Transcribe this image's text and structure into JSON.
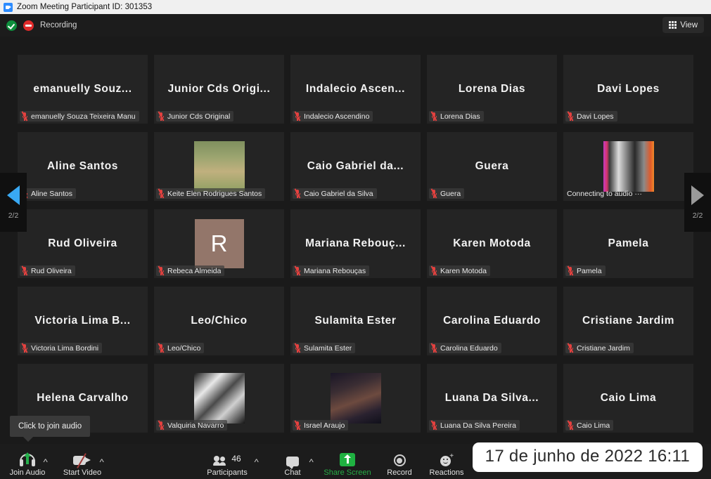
{
  "window": {
    "title": "Zoom Meeting Participant ID: 301353",
    "app_icon": "zoom-icon"
  },
  "header": {
    "encryption_icon": "shield-check-icon",
    "recording_icon": "recording-icon",
    "recording_label": "Recording",
    "view_button": {
      "label": "View",
      "icon": "grid-icon"
    }
  },
  "gallery": {
    "columns": 5,
    "rows": 5,
    "nav": {
      "prev_icon": "chevron-left-icon",
      "prev_page_label": "2/2",
      "next_icon": "chevron-right-icon",
      "next_page_label": "2/2",
      "prev_color": "#39a9f4",
      "next_color": "#9a9a9a"
    },
    "mute_icon": "microphone-off-icon",
    "mute_color": "#e5413f",
    "tiles": [
      {
        "display_name": "emanuelly Souz...",
        "footer_name": "emanuelly Souza Teixeira Manu",
        "muted": true,
        "media": "name"
      },
      {
        "display_name": "Junior Cds Origi...",
        "footer_name": "Junior Cds Original",
        "muted": true,
        "media": "name"
      },
      {
        "display_name": "Indalecio  Ascen...",
        "footer_name": "Indalecio Ascendino",
        "muted": true,
        "media": "name"
      },
      {
        "display_name": "Lorena Dias",
        "footer_name": "Lorena Dias",
        "muted": true,
        "media": "name"
      },
      {
        "display_name": "Davi Lopes",
        "footer_name": "Davi Lopes",
        "muted": true,
        "media": "name"
      },
      {
        "display_name": "Aline Santos",
        "footer_name": "Aline Santos",
        "muted": true,
        "media": "name"
      },
      {
        "display_name": "",
        "footer_name": "Keite Elen Rodrigues Santos",
        "muted": true,
        "media": "photo",
        "photo_style": "outdoor-portrait"
      },
      {
        "display_name": "Caio Gabriel da...",
        "footer_name": "Caio Gabriel da Silva",
        "muted": true,
        "media": "name"
      },
      {
        "display_name": "Guera",
        "footer_name": "Guera",
        "muted": true,
        "media": "name"
      },
      {
        "display_name": "",
        "footer_name": "Connecting to audio ···",
        "muted": false,
        "media": "photo",
        "photo_style": "bw-portrait-gradient"
      },
      {
        "display_name": "Rud Oliveira",
        "footer_name": "Rud Oliveira",
        "muted": true,
        "media": "name"
      },
      {
        "display_name": "",
        "footer_name": "Rebeca Almeida",
        "muted": true,
        "media": "initial",
        "initial": "R",
        "initial_bg": "#93766a"
      },
      {
        "display_name": "Mariana Rebouç...",
        "footer_name": "Mariana Rebouças",
        "muted": true,
        "media": "name"
      },
      {
        "display_name": "Karen Motoda",
        "footer_name": "Karen Motoda",
        "muted": true,
        "media": "name"
      },
      {
        "display_name": "Pamela",
        "footer_name": "Pamela",
        "muted": true,
        "media": "name"
      },
      {
        "display_name": "Victoria  Lima  B...",
        "footer_name": "Victoria Lima Bordini",
        "muted": true,
        "media": "name"
      },
      {
        "display_name": "Leo/Chico",
        "footer_name": "Leo/Chico",
        "muted": true,
        "media": "name"
      },
      {
        "display_name": "Sulamita Ester",
        "footer_name": "Sulamita Ester",
        "muted": true,
        "media": "name"
      },
      {
        "display_name": "Carolina Eduardo",
        "footer_name": "Carolina Eduardo",
        "muted": true,
        "media": "name"
      },
      {
        "display_name": "Cristiane Jardim",
        "footer_name": "Cristiane Jardim",
        "muted": true,
        "media": "name"
      },
      {
        "display_name": "Helena Carvalho",
        "footer_name": "",
        "muted": false,
        "media": "name"
      },
      {
        "display_name": "",
        "footer_name": "Valquiria Navarro",
        "muted": true,
        "media": "photo",
        "photo_style": "bw-indoor-portrait"
      },
      {
        "display_name": "",
        "footer_name": "Israel Araujo",
        "muted": true,
        "media": "photo",
        "photo_style": "group-night-photo"
      },
      {
        "display_name": "Luana Da Silva...",
        "footer_name": "Luana Da Silva Pereira",
        "muted": true,
        "media": "name"
      },
      {
        "display_name": "Caio Lima",
        "footer_name": "Caio Lima",
        "muted": true,
        "media": "name"
      }
    ]
  },
  "tooltip": {
    "text": "Click to join audio"
  },
  "toolbar": {
    "join_audio": {
      "label": "Join Audio",
      "icon": "headset-icon",
      "caret": "˄"
    },
    "start_video": {
      "label": "Start Video",
      "icon": "camera-off-icon",
      "caret": "˄"
    },
    "participants": {
      "label": "Participants",
      "icon": "people-icon",
      "count": "46",
      "caret": "˄"
    },
    "chat": {
      "label": "Chat",
      "icon": "chat-bubble-icon",
      "caret": "˄"
    },
    "share_screen": {
      "label": "Share Screen",
      "icon": "share-screen-icon",
      "color": "#27ad46"
    },
    "record": {
      "label": "Record",
      "icon": "record-circle-icon"
    },
    "reactions": {
      "label": "Reactions",
      "icon": "smiley-plus-icon"
    }
  },
  "overlay": {
    "datetime": "17 de junho de 2022 16:11"
  }
}
